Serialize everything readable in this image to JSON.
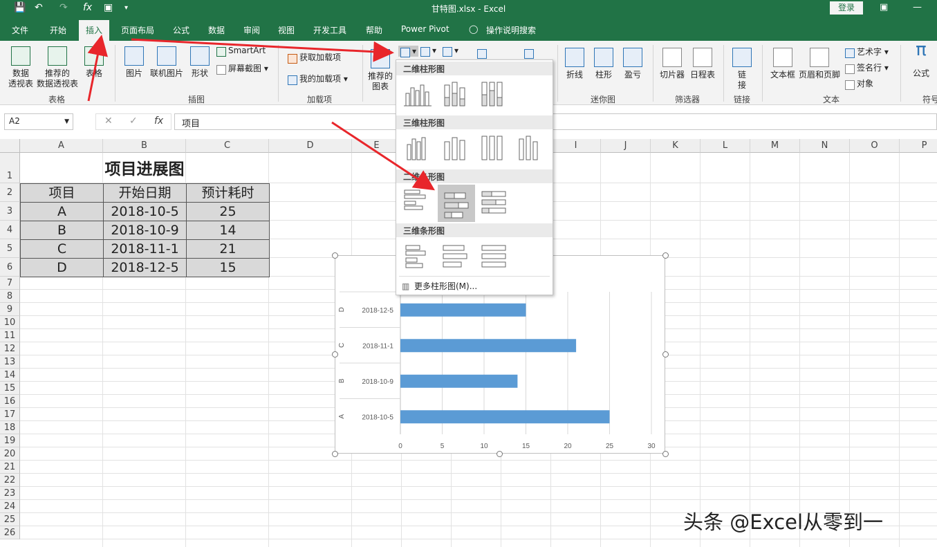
{
  "window": {
    "title": "甘特图.xlsx  -  Excel",
    "login_label": "登录",
    "qat_icons": [
      "save-icon",
      "undo-icon",
      "redo-icon",
      "fx-icon",
      "print-preview-icon",
      "customize-icon"
    ]
  },
  "tabs": [
    "文件",
    "开始",
    "插入",
    "页面布局",
    "公式",
    "数据",
    "审阅",
    "视图",
    "开发工具",
    "帮助",
    "Power Pivot",
    "操作说明搜索"
  ],
  "active_tab": "插入",
  "ribbon": {
    "tables": {
      "pivot": "数据\n透视表",
      "rec_pivot": "推荐的\n数据透视表",
      "table": "表格",
      "label": "表格"
    },
    "illustrations": {
      "pictures": "图片",
      "online_pictures": "联机图片",
      "shapes": "形状",
      "smartart": "SmartArt",
      "screenshot": "屏幕截图",
      "label": "插图"
    },
    "addins": {
      "get": "获取加载项",
      "my": "我的加载项",
      "label": "加载项"
    },
    "charts": {
      "recommended": "推荐的\n图表"
    },
    "sparklines": {
      "line": "折线",
      "column": "柱形",
      "winloss": "盈亏",
      "label": "迷你图"
    },
    "filters": {
      "slicer": "切片器",
      "timeline": "日程表",
      "label": "筛选器"
    },
    "links": {
      "link": "链\n接",
      "label": "链接"
    },
    "text": {
      "textbox": "文本框",
      "header_footer": "页眉和页脚",
      "wordart": "艺术字",
      "signature": "签名行",
      "object": "对象",
      "label": "文本"
    },
    "symbols": {
      "equation": "公式",
      "label": "符号"
    }
  },
  "formula_bar": {
    "name_box": "A2",
    "fx": "fx",
    "value": "项目"
  },
  "columns": [
    "A",
    "B",
    "C",
    "D",
    "E",
    "F",
    "G",
    "H",
    "I",
    "J",
    "K",
    "L",
    "M",
    "N",
    "O",
    "P"
  ],
  "rows": [
    "1",
    "2",
    "3",
    "4",
    "5",
    "6",
    "7",
    "8",
    "9",
    "10",
    "11",
    "12",
    "13",
    "14",
    "15",
    "16",
    "17",
    "18",
    "19",
    "20",
    "21",
    "22",
    "23",
    "24",
    "25",
    "26"
  ],
  "table": {
    "title": "项目进展图",
    "headers": [
      "项目",
      "开始日期",
      "预计耗时"
    ],
    "rows": [
      [
        "A",
        "2018-10-5",
        "25"
      ],
      [
        "B",
        "2018-10-9",
        "14"
      ],
      [
        "C",
        "2018-11-1",
        "21"
      ],
      [
        "D",
        "2018-12-5",
        "15"
      ]
    ]
  },
  "dropdown": {
    "sections": [
      "二维柱形图",
      "三维柱形图",
      "二维条形图",
      "三维条形图"
    ],
    "more": "更多柱形图(M)..."
  },
  "chart_data": {
    "type": "bar",
    "orientation": "horizontal",
    "categories": [
      [
        "A",
        "2018-10-5"
      ],
      [
        "B",
        "2018-10-9"
      ],
      [
        "C",
        "2018-11-1"
      ],
      [
        "D",
        "2018-12-5"
      ]
    ],
    "series": [
      {
        "values": [
          25,
          14,
          21,
          15
        ],
        "color": "#5b9bd5"
      }
    ],
    "xlim": [
      0,
      30
    ],
    "xticks": [
      "0",
      "5",
      "10",
      "15",
      "20",
      "25",
      "30"
    ],
    "grid": true
  },
  "watermark": "头条 @Excel从零到一",
  "colors": {
    "brand": "#217346",
    "bar": "#5b9bd5",
    "arrow": "#e8262b"
  }
}
